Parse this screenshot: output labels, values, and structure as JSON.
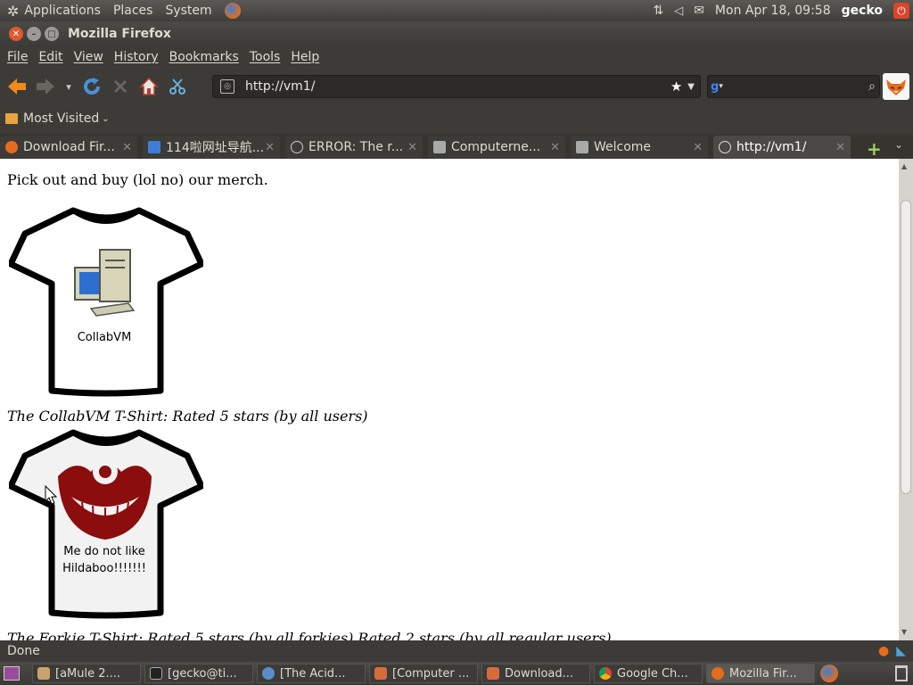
{
  "top_panel": {
    "menu": [
      "Applications",
      "Places",
      "System"
    ],
    "clock": "Mon Apr 18, 09:58",
    "user": "gecko"
  },
  "window": {
    "title": "Mozilla Firefox"
  },
  "menubar": [
    "File",
    "Edit",
    "View",
    "History",
    "Bookmarks",
    "Tools",
    "Help"
  ],
  "navbar": {
    "url": "http://vm1/"
  },
  "bookmarks": {
    "most_visited": "Most Visited"
  },
  "tabs": [
    {
      "label": "Download Fir...",
      "icon_color": "#e76b1c"
    },
    {
      "label": "114啦网址导航...",
      "icon_color": "#3b7dd8"
    },
    {
      "label": "ERROR: The r...",
      "icon_color": "#dddddd"
    },
    {
      "label": "Computerne...",
      "icon_color": "#aaaaaa"
    },
    {
      "label": "Welcome",
      "icon_color": "#aaaaaa"
    },
    {
      "label": "http://vm1/",
      "icon_color": "#dddddd"
    }
  ],
  "page": {
    "intro": "Pick out and buy (lol no) our merch.",
    "shirt1_text": "CollabVM",
    "caption1": "The CollabVM T-Shirt: Rated 5 stars (by all users)",
    "shirt2_line1": "Me do not like",
    "shirt2_line2": "Hildaboo!!!!!!!",
    "caption2": "The Forkie T-Shirt: Rated 5 stars (by all forkies) Rated 2 stars (by all regular users)"
  },
  "status": {
    "text": "Done"
  },
  "taskbar": [
    {
      "label": "[aMule 2....",
      "icon_color": "#c9a36b"
    },
    {
      "label": "[gecko@ti...",
      "icon_color": "#333333"
    },
    {
      "label": "[The Acid...",
      "icon_color": "#5b8dc9"
    },
    {
      "label": "[Computer ...",
      "icon_color": "#d86a3a"
    },
    {
      "label": "Download...",
      "icon_color": "#d86a3a"
    },
    {
      "label": "Google Ch...",
      "icon_color": "#4caf50"
    },
    {
      "label": "Mozilla Fir...",
      "icon_color": "#e76b1c"
    }
  ],
  "colors": {
    "panel": "#3c3b37",
    "accent": "#e2582c",
    "shirt_print": "#8b0d0d"
  }
}
